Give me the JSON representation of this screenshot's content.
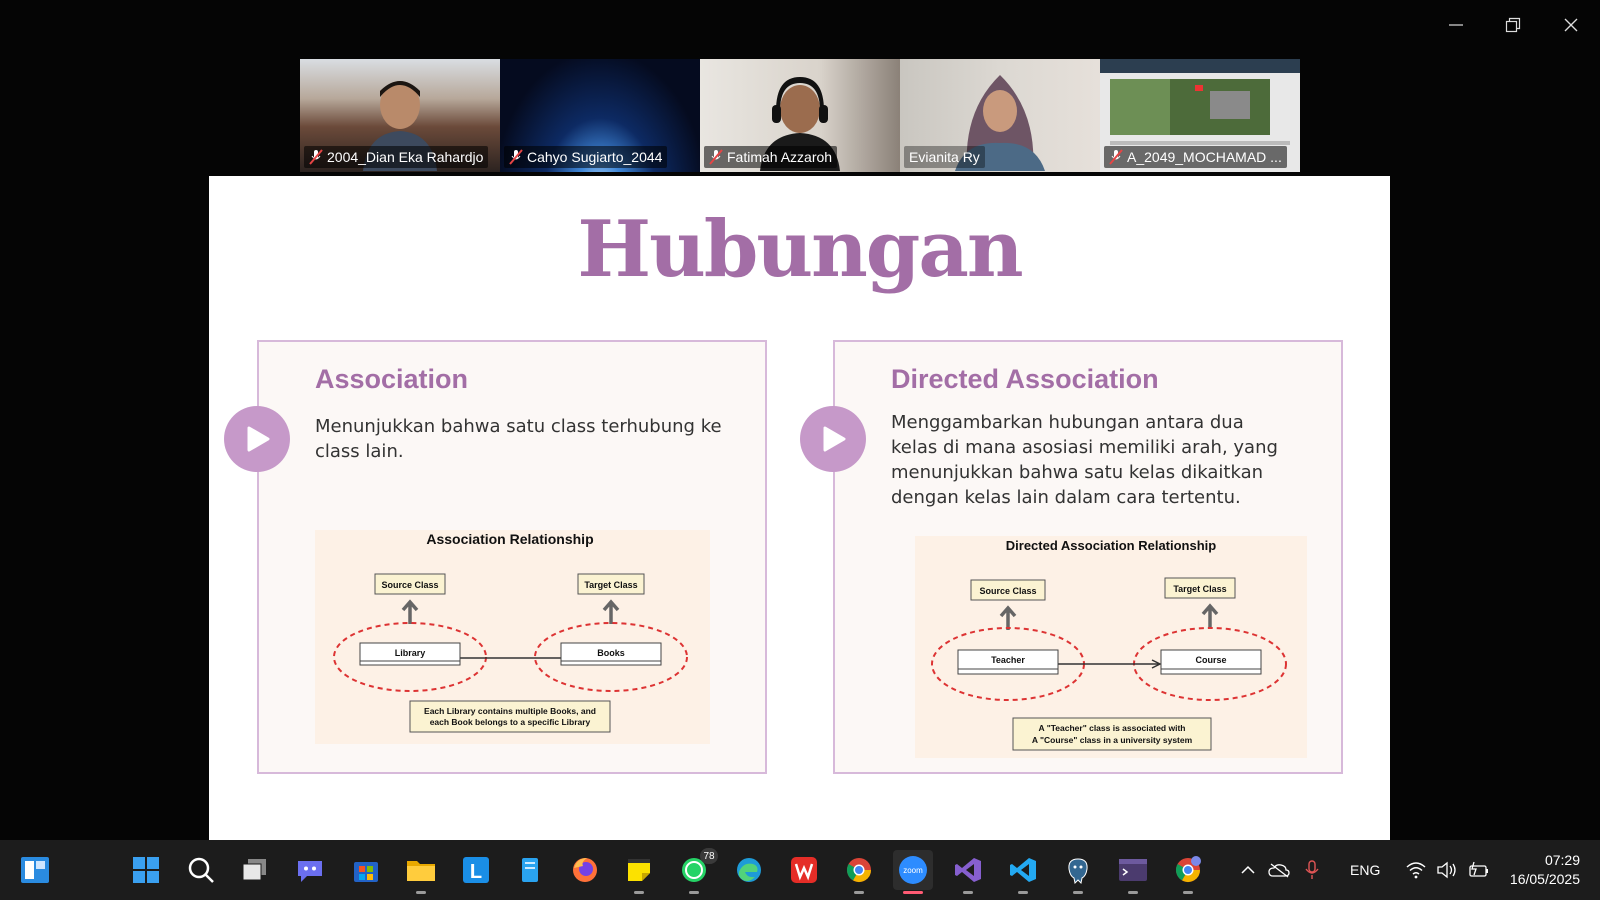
{
  "meeting": {
    "participants": [
      {
        "name": "2004_Dian Eka Rahardjo",
        "muted": true
      },
      {
        "name": "Cahyo Sugiarto_2044",
        "muted": true
      },
      {
        "name": "Fatimah Azzaroh",
        "muted": true
      },
      {
        "name": "Evianita Ry",
        "muted": false,
        "speaking": true
      },
      {
        "name": "A_2049_MOCHAMAD ...",
        "muted": true
      }
    ]
  },
  "slide": {
    "title": "Hubungan",
    "cards": [
      {
        "heading": "Association",
        "body": "Menunjukkan bahwa satu class terhubung ke  class lain.",
        "diagram": {
          "title": "Association Relationship",
          "source_label": "Source Class",
          "target_label": "Target Class",
          "left_class": "Library",
          "right_class": "Books",
          "note_line1": "Each Library contains multiple Books, and",
          "note_line2": "each Book belongs to a specific Library"
        }
      },
      {
        "heading": "Directed Association",
        "body": "Menggambarkan hubungan antara dua kelas di mana asosiasi memiliki arah, yang menunjukkan bahwa satu kelas dikaitkan dengan kelas lain dalam cara tertentu.",
        "diagram": {
          "title": "Directed Association Relationship",
          "source_label": "Source Class",
          "target_label": "Target Class",
          "left_class": "Teacher",
          "right_class": "Course",
          "note_line1": "A \"Teacher\" class is associated with",
          "note_line2": "A \"Course\" class in a university system"
        }
      }
    ]
  },
  "taskbar": {
    "icons": [
      "start-icon",
      "search-icon",
      "task-view-icon",
      "teams-chat-icon",
      "store-icon",
      "file-explorer-icon",
      "l-app-icon",
      "notepad-icon",
      "firefox-icon",
      "sticky-notes-icon",
      "whatsapp-icon",
      "edge-icon",
      "wps-office-icon",
      "chrome-icon",
      "zoom-icon",
      "visual-studio-icon",
      "vscode-icon",
      "postgresql-icon",
      "terminal-icon",
      "chrome-profile-icon"
    ],
    "whatsapp_badge": "78",
    "tray_language": "ENG",
    "time": "07:29",
    "date": "16/05/2025"
  }
}
